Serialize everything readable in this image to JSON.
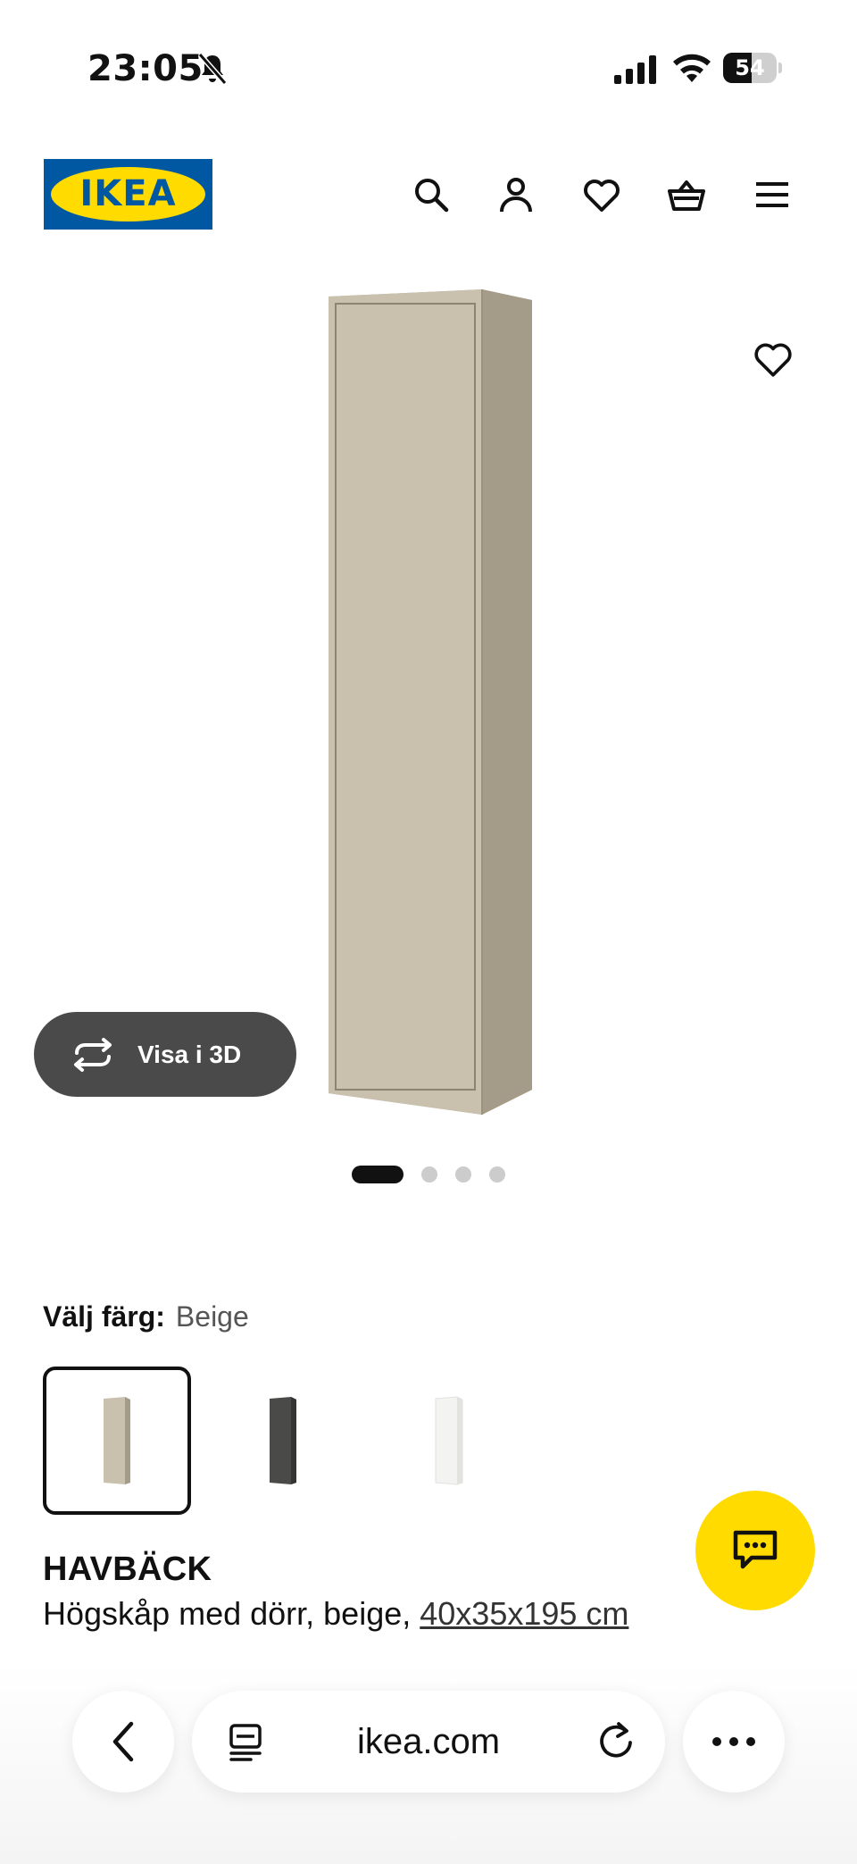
{
  "status_bar": {
    "time": "23:05",
    "battery_level": "54",
    "battery_fraction": 0.54
  },
  "header": {
    "logo_text": "IKEA",
    "icons": [
      "search-icon",
      "account-icon",
      "favorites-icon",
      "cart-icon",
      "menu-icon"
    ]
  },
  "gallery": {
    "view_3d_label": "Visa i 3D",
    "image_count": 4,
    "active_index": 0
  },
  "color_picker": {
    "label": "Välj färg:",
    "selected_value": "Beige",
    "options": [
      {
        "name": "Beige",
        "color": "#c9c0ad",
        "selected": true
      },
      {
        "name": "Dark grey",
        "color": "#4a4a48",
        "selected": false
      },
      {
        "name": "White",
        "color": "#f3f3f1",
        "selected": false
      }
    ]
  },
  "product": {
    "name": "HAVBÄCK",
    "description": "Högskåp med dörr, beige,",
    "dimensions": "40x35x195 cm"
  },
  "browser": {
    "url": "ikea.com"
  },
  "colors": {
    "ikea_blue": "#0058a3",
    "ikea_yellow": "#ffdb00",
    "beige": "#c9c0ad"
  }
}
